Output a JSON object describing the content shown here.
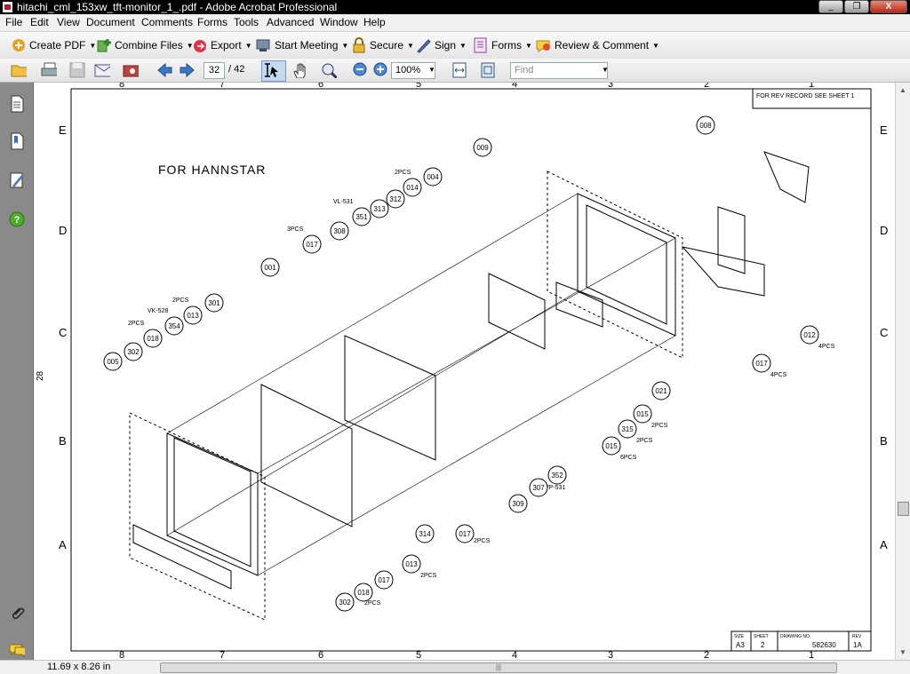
{
  "window": {
    "title": "hitachi_cml_153xw_tft-monitor_1_.pdf - Adobe Acrobat Professional",
    "buttons": {
      "minimize": "_",
      "restore": "❐",
      "close": "X"
    }
  },
  "menu": [
    "File",
    "Edit",
    "View",
    "Document",
    "Comments",
    "Forms",
    "Tools",
    "Advanced",
    "Window",
    "Help"
  ],
  "tasks": [
    {
      "label": "Create PDF",
      "icon": "create-pdf-icon"
    },
    {
      "label": "Combine Files",
      "icon": "combine-files-icon"
    },
    {
      "label": "Export",
      "icon": "export-icon"
    },
    {
      "label": "Start Meeting",
      "icon": "meeting-icon"
    },
    {
      "label": "Secure",
      "icon": "lock-icon"
    },
    {
      "label": "Sign",
      "icon": "pen-icon"
    },
    {
      "label": "Forms",
      "icon": "forms-icon"
    },
    {
      "label": "Review & Comment",
      "icon": "comment-icon"
    }
  ],
  "nav": {
    "page_current": "32",
    "page_total": "/ 42",
    "zoom": "100%",
    "find_placeholder": "Find"
  },
  "status": {
    "page_size": "11.69 x 8.26 in",
    "scroll_grip": "|||"
  },
  "drawing": {
    "note": "FOR HANNSTAR",
    "rev_record": "FOR REV RECORD SEE SHEET 1",
    "side_number": "28",
    "title_block": {
      "size_label": "SIZE",
      "size": "A3",
      "sheet_label": "SHEET",
      "sheet": "2",
      "drawing_no_label": "DRAWING NO.",
      "drawing_no": "582630",
      "rev_label": "REV",
      "rev": "1A"
    },
    "row_letters": [
      "E",
      "D",
      "C",
      "B",
      "A"
    ],
    "col_numbers": [
      "8",
      "7",
      "6",
      "5",
      "4",
      "3",
      "2",
      "1"
    ],
    "callouts": [
      {
        "id": "008",
        "note": ""
      },
      {
        "id": "009",
        "note": ""
      },
      {
        "id": "004",
        "note": ""
      },
      {
        "id": "014",
        "note": "2PCS"
      },
      {
        "id": "312",
        "note": ""
      },
      {
        "id": "313",
        "note": ""
      },
      {
        "id": "351",
        "note": "VL-531"
      },
      {
        "id": "308",
        "note": ""
      },
      {
        "id": "017",
        "note": "3PCS"
      },
      {
        "id": "001",
        "note": ""
      },
      {
        "id": "301",
        "note": ""
      },
      {
        "id": "013",
        "note": "2PCS"
      },
      {
        "id": "354",
        "note": "VK-528"
      },
      {
        "id": "018",
        "note": "2PCS"
      },
      {
        "id": "302",
        "note": ""
      },
      {
        "id": "005",
        "note": ""
      },
      {
        "id": "012",
        "note": "4PCS"
      },
      {
        "id": "017",
        "note": "4PCS"
      },
      {
        "id": "021",
        "note": ""
      },
      {
        "id": "015",
        "note": "2PCS"
      },
      {
        "id": "315",
        "note": "2PCS"
      },
      {
        "id": "015",
        "note": "6PCS"
      },
      {
        "id": "352",
        "note": "VP-531"
      },
      {
        "id": "307",
        "note": ""
      },
      {
        "id": "309",
        "note": ""
      },
      {
        "id": "017",
        "note": "2PCS"
      },
      {
        "id": "314",
        "note": ""
      },
      {
        "id": "013",
        "note": "2PCS"
      },
      {
        "id": "017",
        "note": ""
      },
      {
        "id": "018",
        "note": "2PCS"
      },
      {
        "id": "302",
        "note": ""
      }
    ]
  }
}
